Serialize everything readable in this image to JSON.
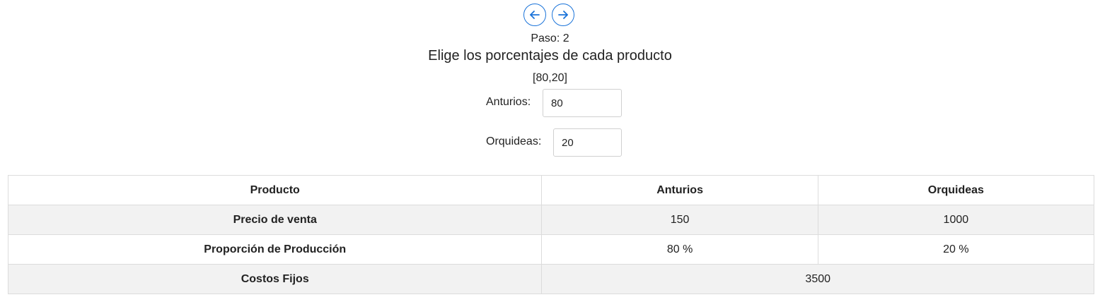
{
  "nav": {
    "prev_icon": "arrow-left-icon",
    "next_icon": "arrow-right-icon",
    "accent_color": "#1a73d9"
  },
  "step_label": "Paso: 2",
  "heading": "Elige los porcentajes de cada producto",
  "array_text": "[80,20]",
  "fields": {
    "anturios": {
      "label": "Anturios:",
      "value": "80"
    },
    "orquideas": {
      "label": "Orquideas:",
      "value": "20"
    }
  },
  "table": {
    "headers": [
      "Producto",
      "Anturios",
      "Orquideas"
    ],
    "rows": [
      {
        "label": "Precio de venta",
        "anturios": "150",
        "orquideas": "1000"
      },
      {
        "label": "Proporción de Producción",
        "anturios": "80 %",
        "orquideas": "20 %"
      },
      {
        "label": "Costos Fijos",
        "combined": "3500"
      }
    ]
  }
}
